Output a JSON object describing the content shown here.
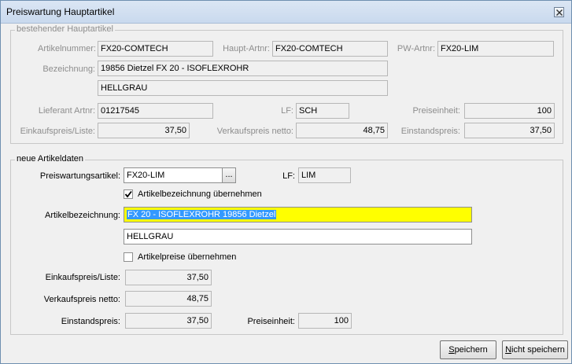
{
  "window": {
    "title": "Preiswartung Hauptartikel"
  },
  "existing": {
    "legend": "bestehender Hauptartikel",
    "artikelnummer": {
      "label": "Artikelnummer:",
      "value": "FX20-COMTECH"
    },
    "haupt_artnr": {
      "label": "Haupt-Artnr:",
      "value": "FX20-COMTECH"
    },
    "pw_artnr": {
      "label": "PW-Artnr:",
      "value": "FX20-LIM"
    },
    "bezeichnung": {
      "label": "Bezeichnung:",
      "value1": "19856 Dietzel FX 20 - ISOFLEXROHR",
      "value2": "HELLGRAU"
    },
    "lieferant_artnr": {
      "label": "Lieferant Artnr:",
      "value": "01217545"
    },
    "lf": {
      "label": "LF:",
      "value": "SCH"
    },
    "preiseinheit": {
      "label": "Preiseinheit:",
      "value": "100"
    },
    "einkaufspreis": {
      "label": "Einkaufspreis/Liste:",
      "value": "37,50"
    },
    "verkaufspreis": {
      "label": "Verkaufspreis netto:",
      "value": "48,75"
    },
    "einstandspreis": {
      "label": "Einstandspreis:",
      "value": "37,50"
    }
  },
  "new": {
    "legend": "neue Artikeldaten",
    "preiswartungsartikel": {
      "label": "Preiswartungsartikel:",
      "value": "FX20-LIM",
      "browse": "..."
    },
    "lf": {
      "label": "LF:",
      "value": "LIM"
    },
    "chk_bezeichnung": {
      "label": "Artikelbezeichnung übernehmen",
      "checked": true
    },
    "artikelbezeichnung": {
      "label": "Artikelbezeichnung:",
      "value1": "FX 20 - ISOFLEXROHR 19856 Dietzel",
      "value2": "HELLGRAU"
    },
    "chk_preise": {
      "label": "Artikelpreise übernehmen",
      "checked": false
    },
    "einkaufspreis": {
      "label": "Einkaufspreis/Liste:",
      "value": "37,50"
    },
    "verkaufspreis": {
      "label": "Verkaufspreis netto:",
      "value": "48,75"
    },
    "einstandspreis": {
      "label": "Einstandspreis:",
      "value": "37,50"
    },
    "preiseinheit": {
      "label": "Preiseinheit:",
      "value": "100"
    }
  },
  "buttons": {
    "save": {
      "mnemonic": "S",
      "rest": "peichern"
    },
    "dont_save": {
      "mnemonic": "N",
      "rest": "icht speichern"
    }
  }
}
